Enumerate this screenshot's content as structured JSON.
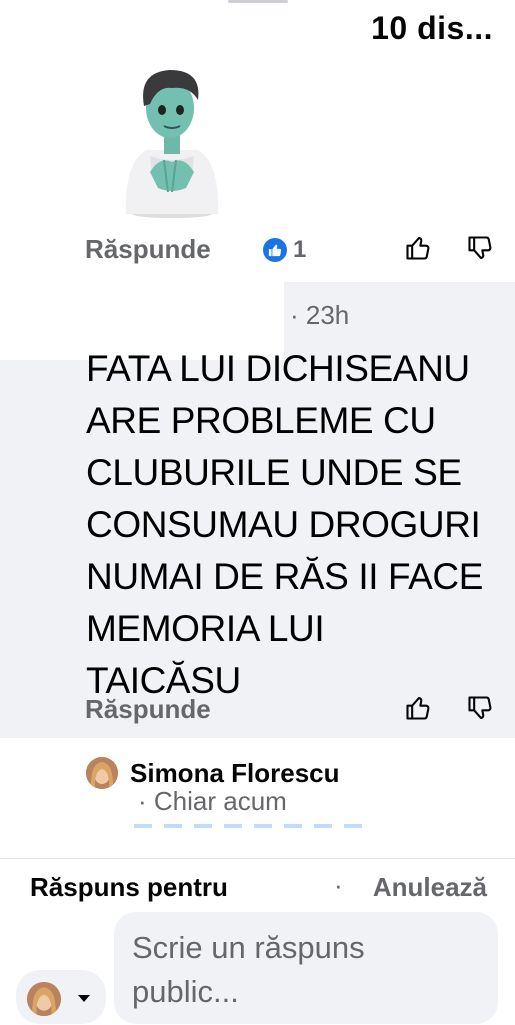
{
  "header": {
    "time_label": "10 dis..."
  },
  "first_comment": {
    "reply_label": "Răspunde",
    "like_count": "1"
  },
  "comment": {
    "time": "· 23h",
    "text": "FATA LUI DICHISEANU\nARE PROBLEME CU\nCLUBURILE  UNDE SE\nCONSUMAU DROGURI\nNUMAI DE RĂS  II FACE\nMEMORIA LUI\nTAICĂSU",
    "reply_label": "Răspunde"
  },
  "draft_reply": {
    "author": "Simona Florescu",
    "time": "· Chiar acum"
  },
  "composer": {
    "reply_to_label": "Răspuns pentru",
    "cancel_label": "Anulează",
    "placeholder": "Scrie un răspuns\npublic..."
  },
  "colors": {
    "accent": "#1b74e4",
    "muted_text": "#65676b",
    "comment_bg": "#f0f2f5"
  },
  "icons": [
    "like-badge-icon",
    "thumbs-up-icon",
    "thumbs-down-icon",
    "caret-down-icon"
  ]
}
